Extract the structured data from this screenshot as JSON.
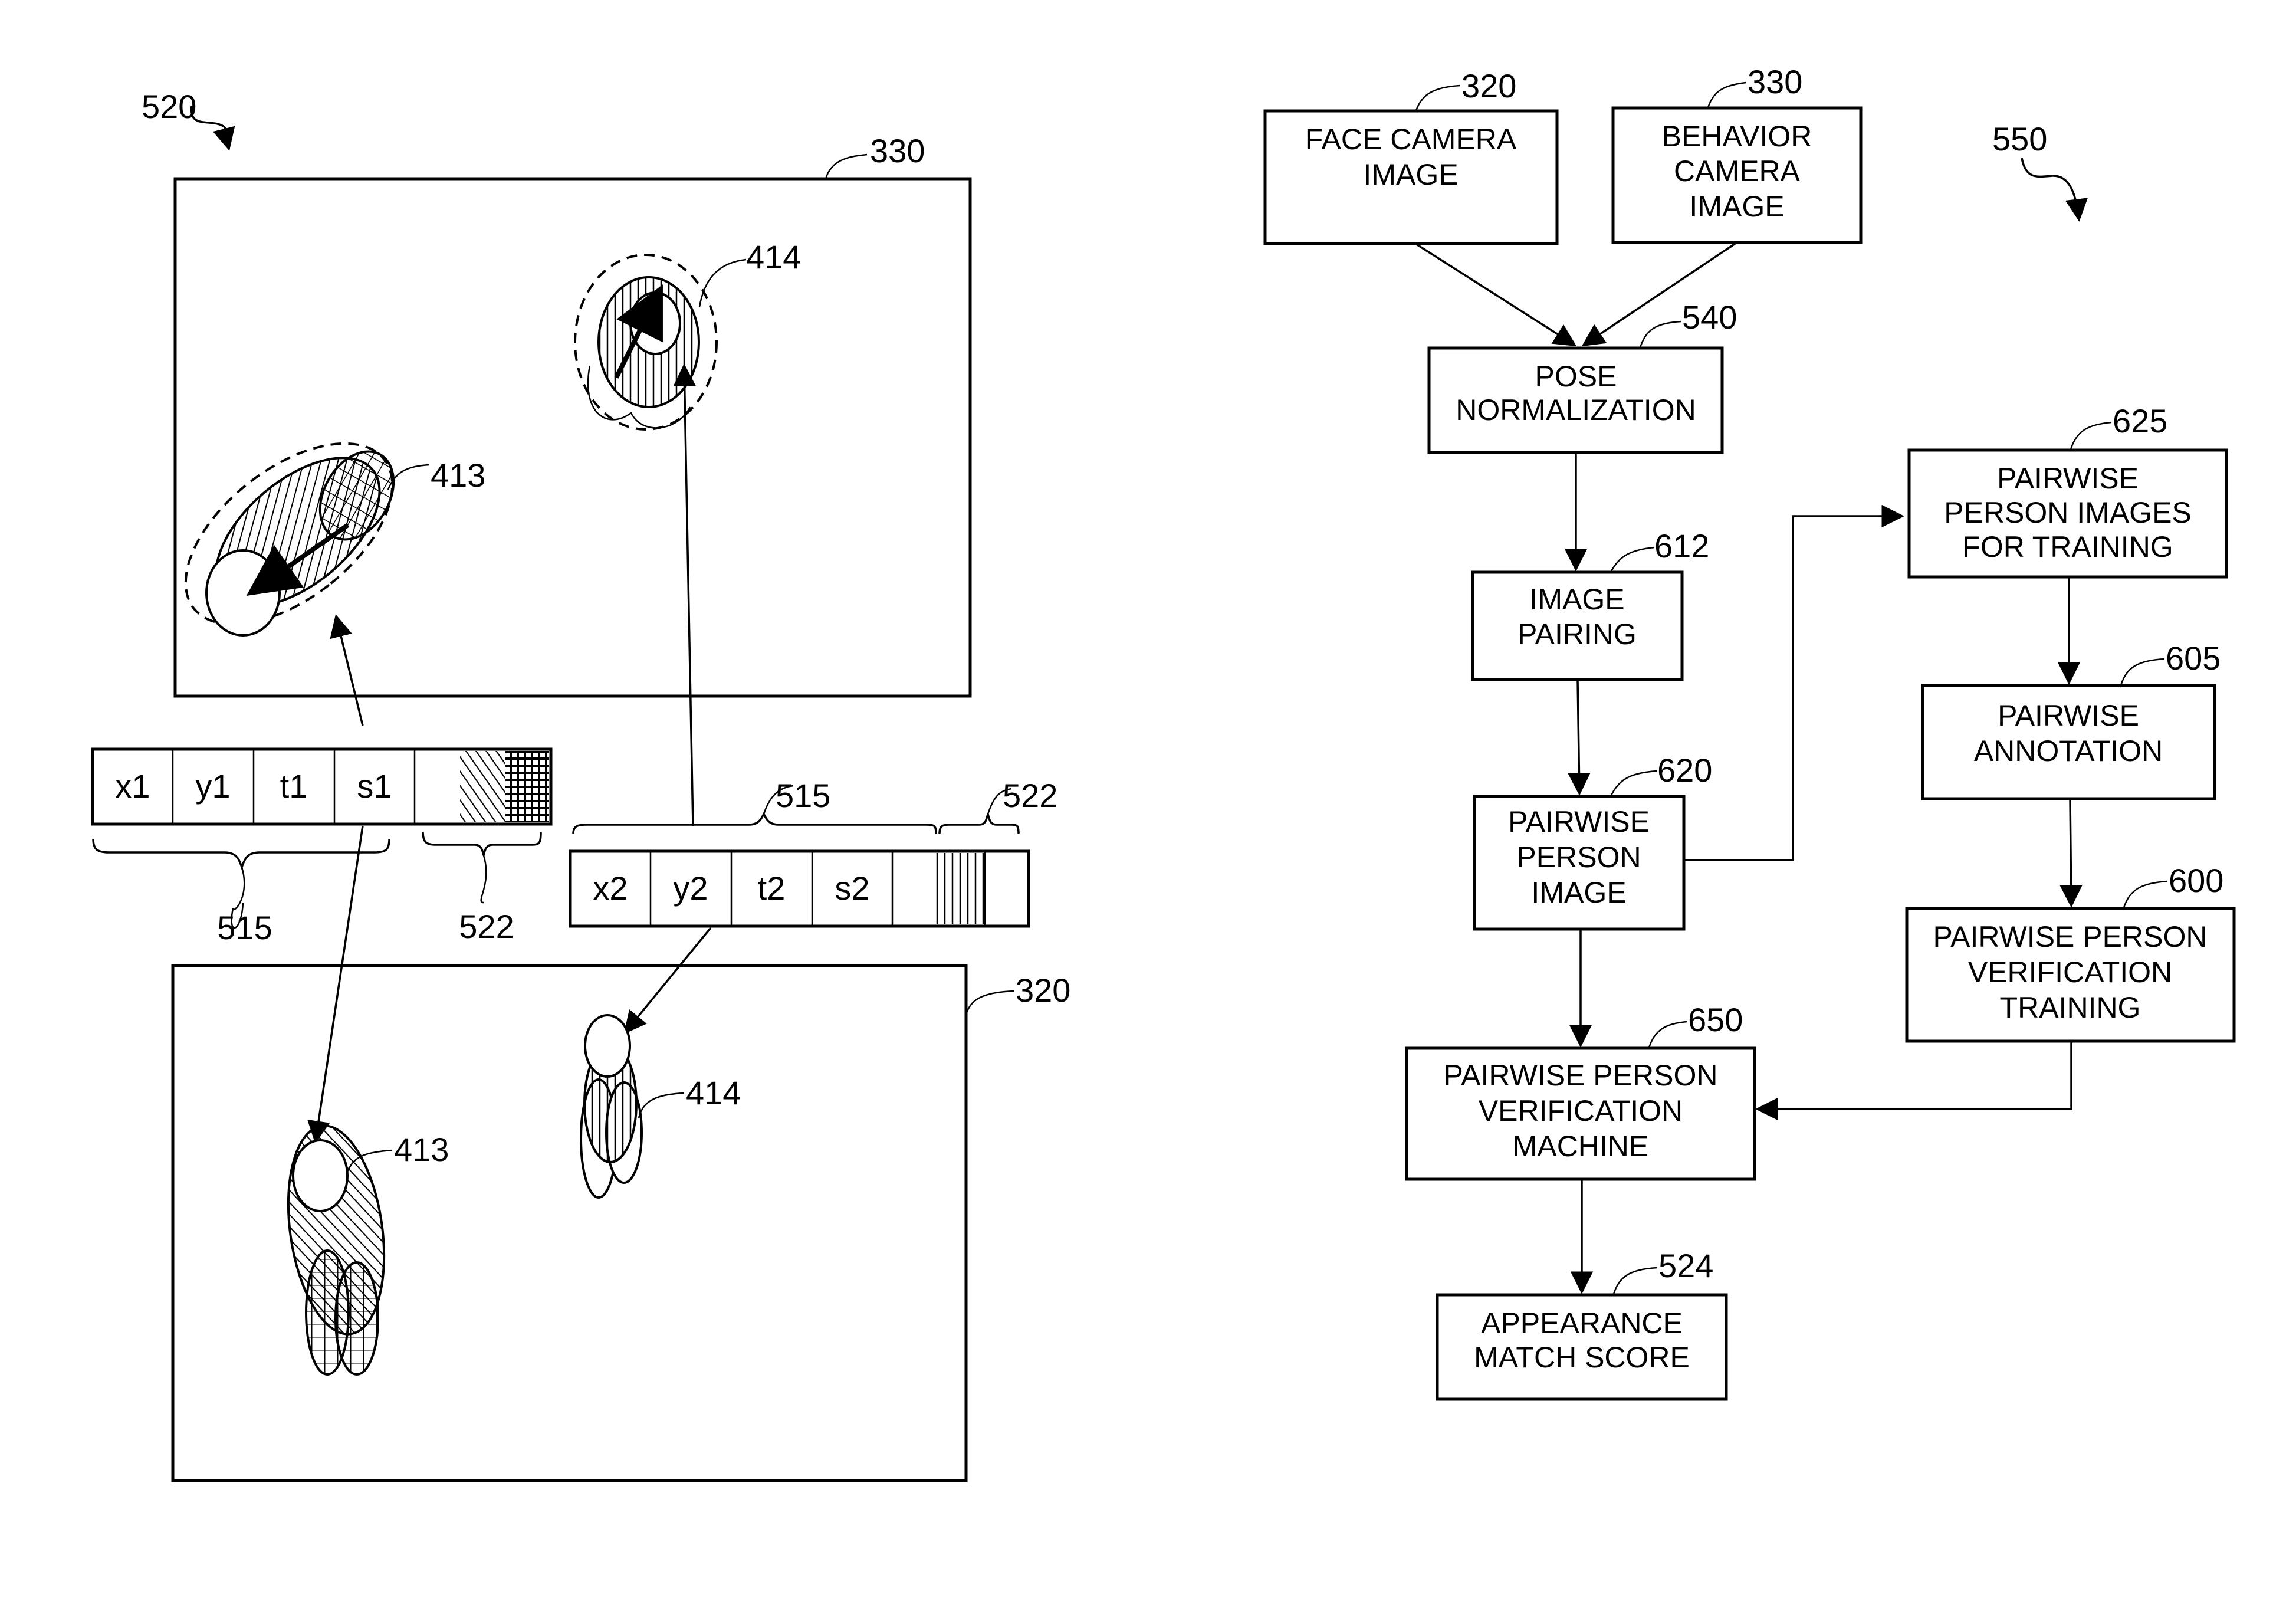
{
  "figure_left": {
    "label": "520",
    "behavior_frame": {
      "ref": "330",
      "persons": [
        {
          "ref": "413",
          "pattern": "diagonal-hatch",
          "secondary_pattern": "crosshatch"
        },
        {
          "ref": "414",
          "pattern": "vertical-hatch"
        }
      ]
    },
    "descriptor_1": {
      "cells": [
        "x1",
        "y1",
        "t1",
        "s1"
      ],
      "color_cells": [
        "blank",
        "diagonal-hatch",
        "crosshatch"
      ],
      "brace_refs": {
        "spatial": "515",
        "color": "522"
      }
    },
    "descriptor_2": {
      "cells": [
        "x2",
        "y2",
        "t2",
        "s2"
      ],
      "color_cells": [
        "blank",
        "vertical-hatch",
        "blank"
      ],
      "brace_refs": {
        "spatial": "515",
        "color": "522"
      }
    },
    "face_frame": {
      "ref": "320",
      "persons": [
        {
          "ref": "413"
        },
        {
          "ref": "414"
        }
      ]
    }
  },
  "flowchart": {
    "label": "550",
    "boxes": {
      "face_camera": {
        "ref": "320",
        "lines": [
          "FACE CAMERA",
          "IMAGE"
        ]
      },
      "behavior_camera": {
        "ref": "330",
        "lines": [
          "BEHAVIOR",
          "CAMERA",
          "IMAGE"
        ]
      },
      "pose_norm": {
        "ref": "540",
        "lines": [
          "POSE",
          "NORMALIZATION"
        ]
      },
      "image_pairing": {
        "ref": "612",
        "lines": [
          "IMAGE",
          "PAIRING"
        ]
      },
      "pairwise_person_image": {
        "ref": "620",
        "lines": [
          "PAIRWISE",
          "PERSON",
          "IMAGE"
        ]
      },
      "training_images": {
        "ref": "625",
        "lines": [
          "PAIRWISE",
          "PERSON IMAGES",
          "FOR TRAINING"
        ]
      },
      "annotation": {
        "ref": "605",
        "lines": [
          "PAIRWISE",
          "ANNOTATION"
        ]
      },
      "verification_training": {
        "ref": "600",
        "lines": [
          "PAIRWISE PERSON",
          "VERIFICATION",
          "TRAINING"
        ]
      },
      "verification_machine": {
        "ref": "650",
        "lines": [
          "PAIRWISE PERSON",
          "VERIFICATION",
          "MACHINE"
        ]
      },
      "match_score": {
        "ref": "524",
        "lines": [
          "APPEARANCE",
          "MATCH SCORE"
        ]
      }
    }
  }
}
